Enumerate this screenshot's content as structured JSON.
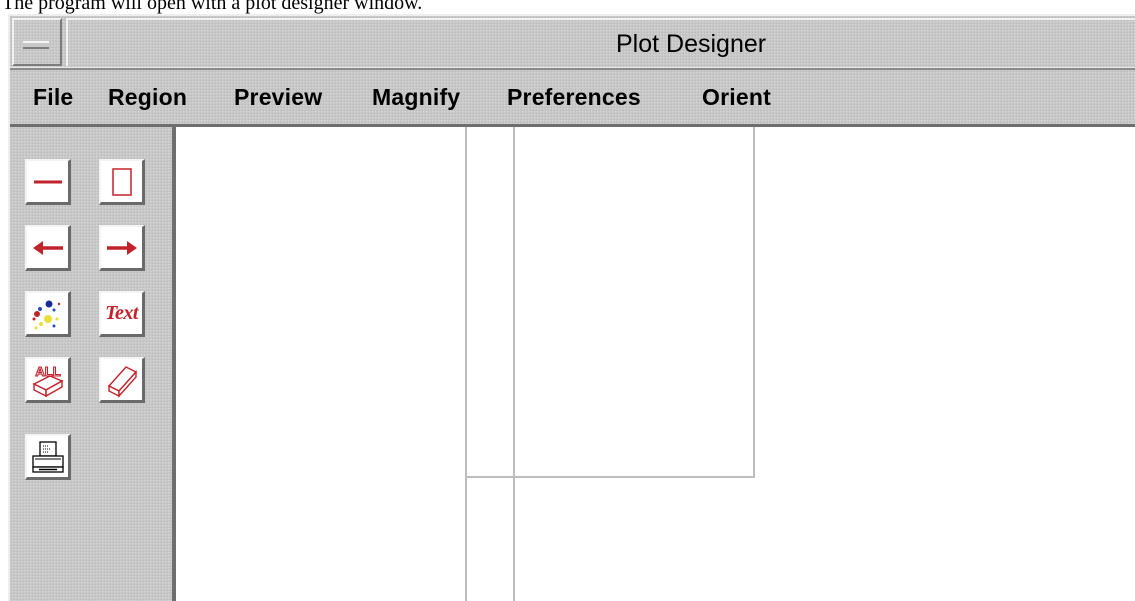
{
  "caption": "The program will open with a plot designer window.",
  "window": {
    "title": "Plot Designer",
    "system_menu_icon": "window-menu-icon"
  },
  "menubar": {
    "items": [
      "File",
      "Region",
      "Preview",
      "Magnify",
      "Preferences",
      "Orient"
    ]
  },
  "toolbox": {
    "tools": [
      {
        "id": "line",
        "icon": "line-tool-icon"
      },
      {
        "id": "rectangle",
        "icon": "rectangle-tool-icon"
      },
      {
        "id": "arrow-left",
        "icon": "arrow-left-icon"
      },
      {
        "id": "arrow-right",
        "icon": "arrow-right-icon"
      },
      {
        "id": "markers",
        "icon": "color-dots-icon"
      },
      {
        "id": "text",
        "icon": "text-tool-icon",
        "label": "Text"
      },
      {
        "id": "erase-all",
        "icon": "erase-all-icon",
        "label": "ALL"
      },
      {
        "id": "eraser",
        "icon": "eraser-icon"
      },
      {
        "id": "print",
        "icon": "printer-icon"
      }
    ]
  },
  "colors": {
    "tool_red": "#c2222a",
    "window_gray": "#c8c8c8",
    "guide_gray": "#bdbdbd"
  }
}
